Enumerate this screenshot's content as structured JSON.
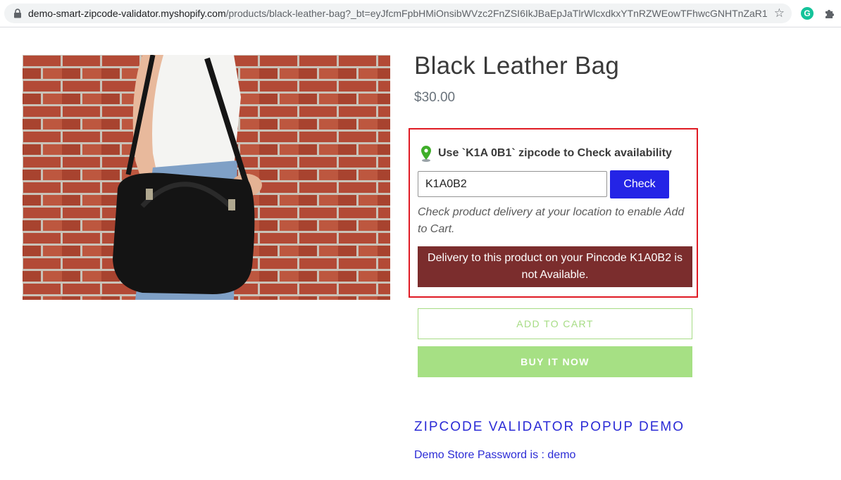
{
  "browser": {
    "url_host": "demo-smart-zipcode-validator.myshopify.com",
    "url_path": "/products/black-leather-bag?_bt=eyJfcmFpbHMiOnsibWVzc2FnZSI6IkJBaEpJaTlrWlcxdkxYTnRZWEowTFhwcGNHTnZaR1V..."
  },
  "product": {
    "title": "Black Leather Bag",
    "price": "$30.00"
  },
  "zipcode_checker": {
    "hint": "Use `K1A 0B1` zipcode to Check availability",
    "input_value": "K1A0B2",
    "check_label": "Check",
    "note": "Check product delivery at your location to enable Add to Cart.",
    "error": "Delivery to this product on your Pincode K1A0B2 is not Available."
  },
  "actions": {
    "add_to_cart": "ADD TO CART",
    "buy_now": "BUY IT NOW"
  },
  "description": {
    "heading": "ZIPCODE VALIDATOR POPUP DEMO",
    "password_note": "Demo Store Password is : demo"
  },
  "colors": {
    "check_button": "#2424e6",
    "error_background": "#7b2d2d",
    "highlight_border": "#e01b24",
    "cart_green": "#a6dc84",
    "link_blue": "#2b2bd6"
  },
  "icons": [
    "lock-icon",
    "star-icon",
    "grammarly-icon",
    "puzzle-icon",
    "location-pin-icon"
  ]
}
